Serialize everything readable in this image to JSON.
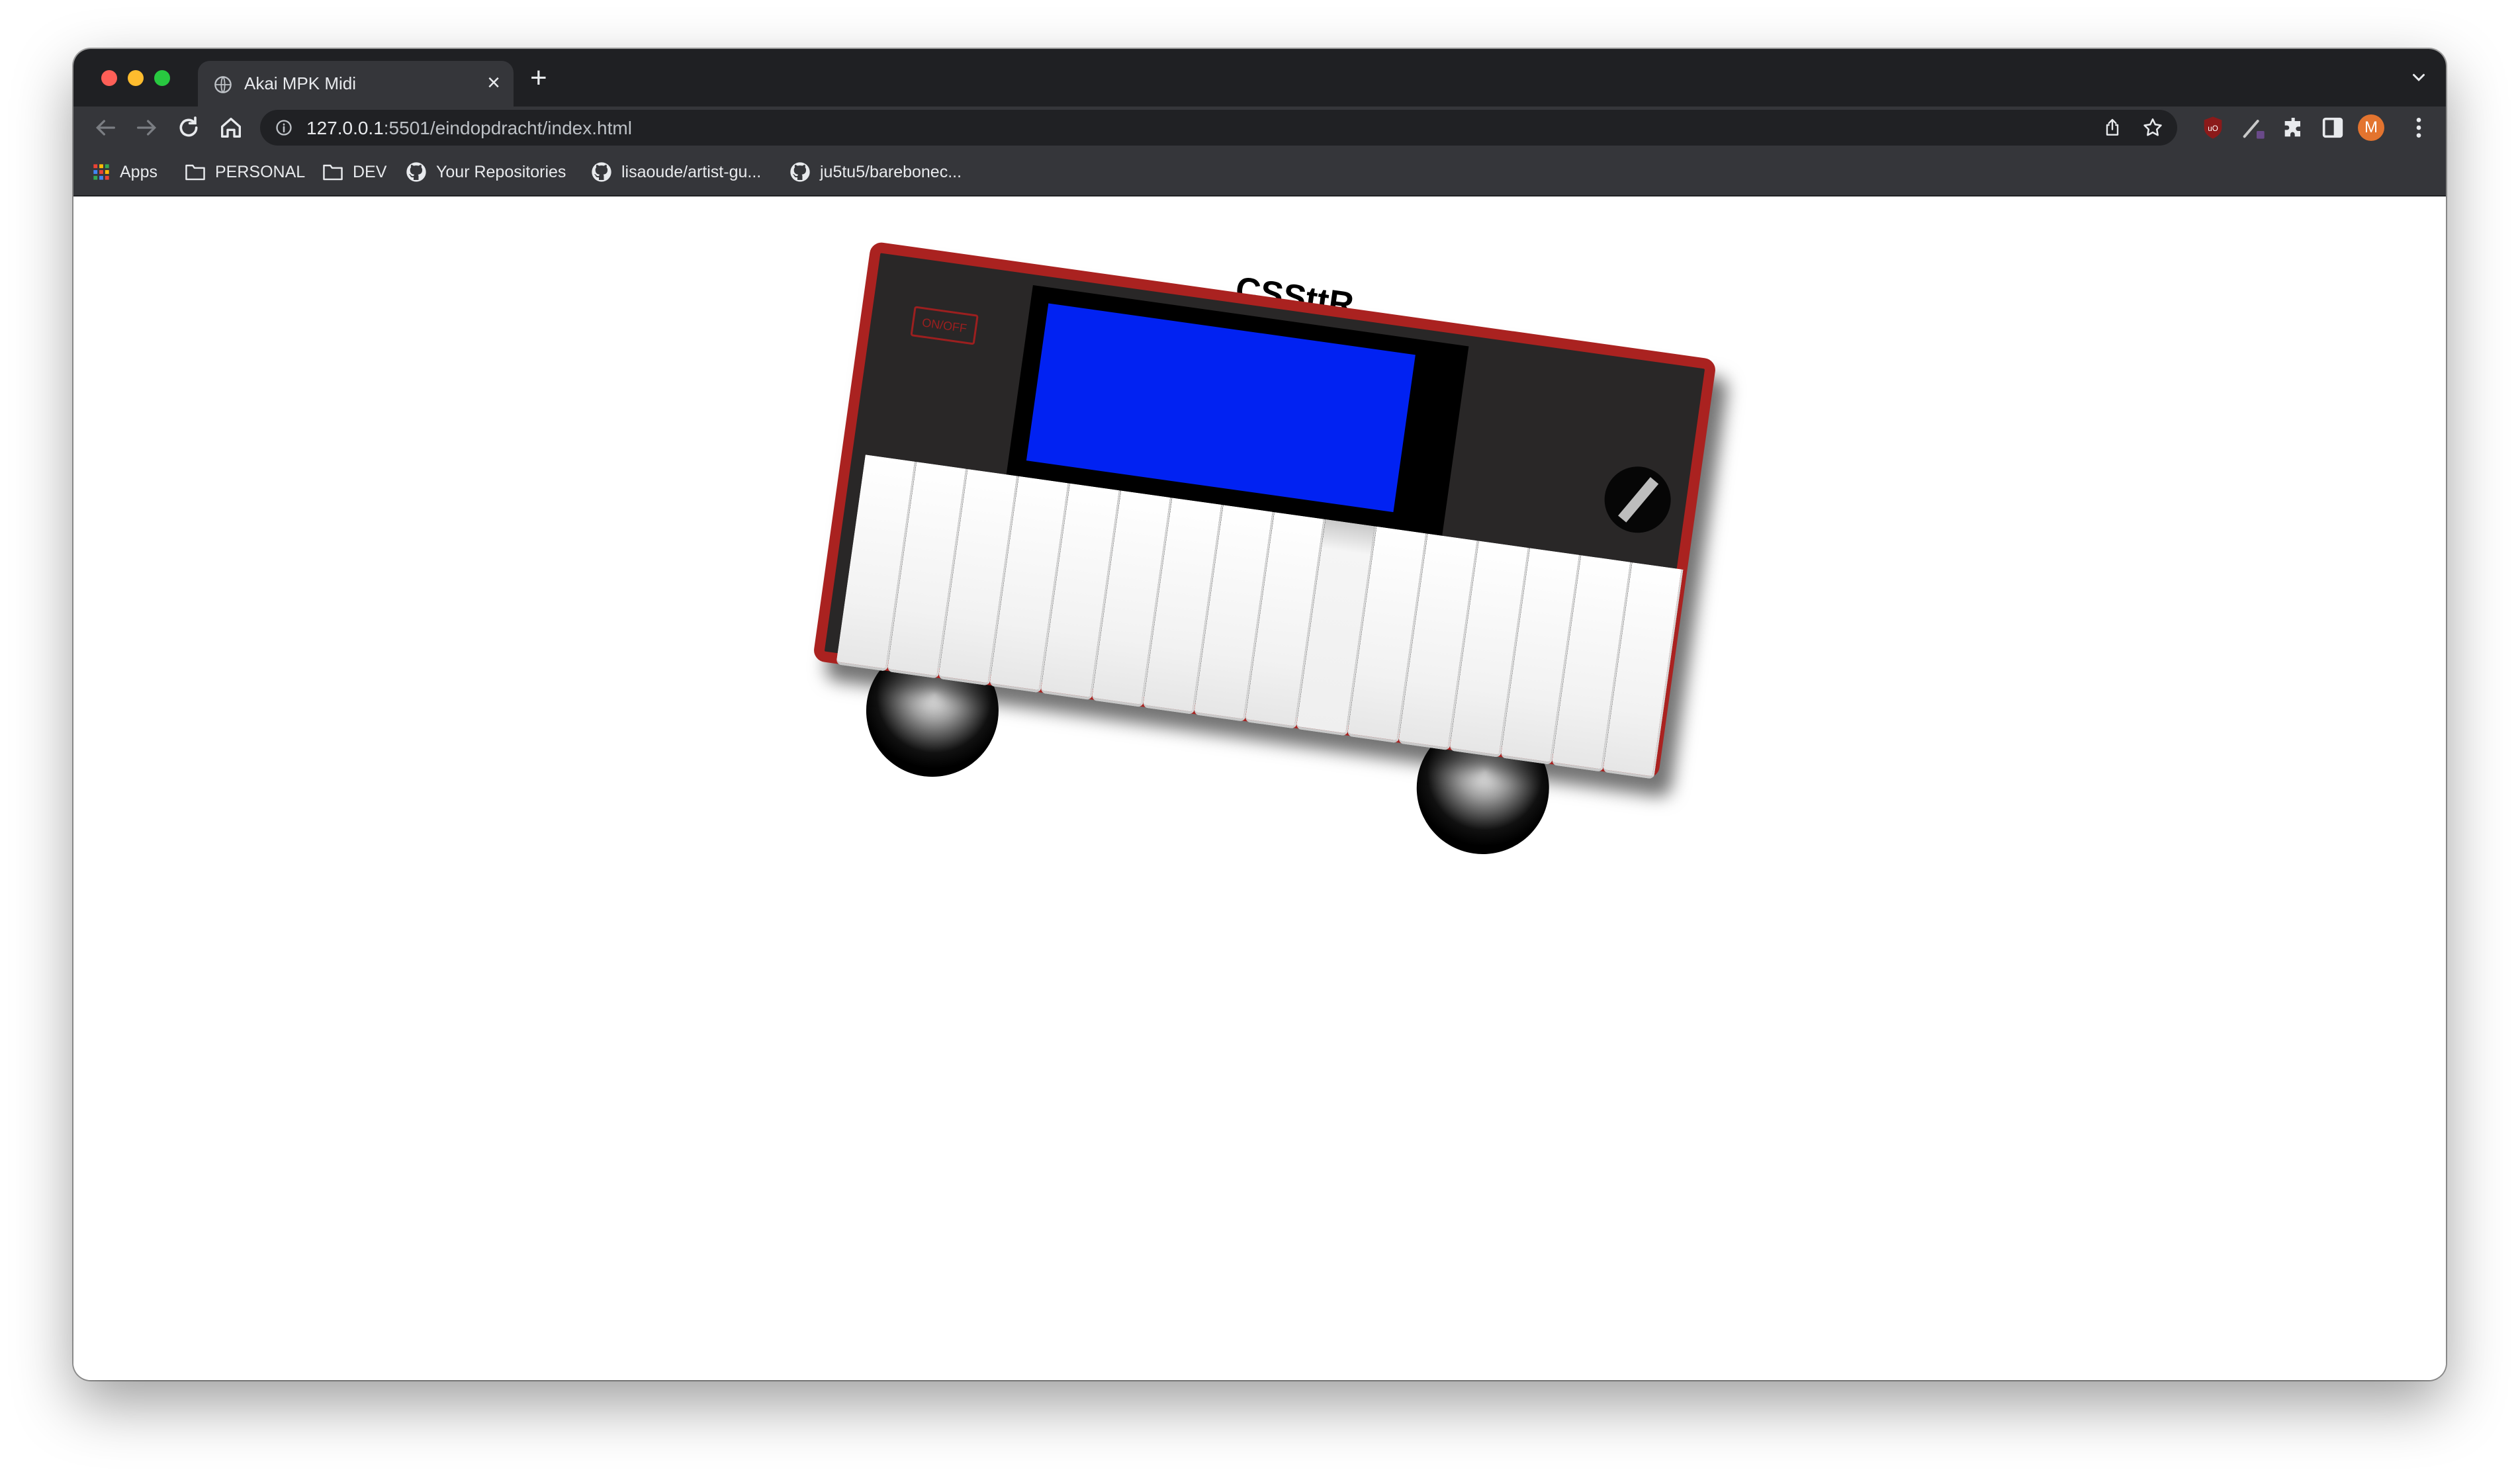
{
  "browser": {
    "tab": {
      "title": "Akai MPK Midi",
      "close_glyph": "×",
      "favicon": "globe-icon"
    },
    "new_tab_glyph": "+",
    "url": {
      "host": "127.0.0.1",
      "rest": ":5501/eindopdracht/index.html"
    },
    "profile_initial": "M",
    "bookmarks": [
      {
        "label": "Apps",
        "icon": "apps-grid-icon"
      },
      {
        "label": "PERSONAL",
        "icon": "folder-icon"
      },
      {
        "label": "DEV",
        "icon": "folder-icon"
      },
      {
        "label": "Your Repositories",
        "icon": "github-icon"
      },
      {
        "label": "lisaoude/artist-gu...",
        "icon": "github-icon"
      },
      {
        "label": "ju5tu5/barebonec...",
        "icon": "github-icon"
      }
    ],
    "colors": {
      "frame": "#1f2023",
      "toolbar": "#35363a",
      "avatar": "#e3742f",
      "ublock": "#8b1a1a"
    }
  },
  "page": {
    "title": "CSSttR",
    "power_button_label": "ON/OFF",
    "key_count": 16,
    "pressed_key": 9,
    "colors": {
      "case_border": "#aa2220",
      "case_body": "#292727",
      "screen": "#0122f2",
      "screen_frame": "#000000",
      "knob": "#060606"
    }
  }
}
